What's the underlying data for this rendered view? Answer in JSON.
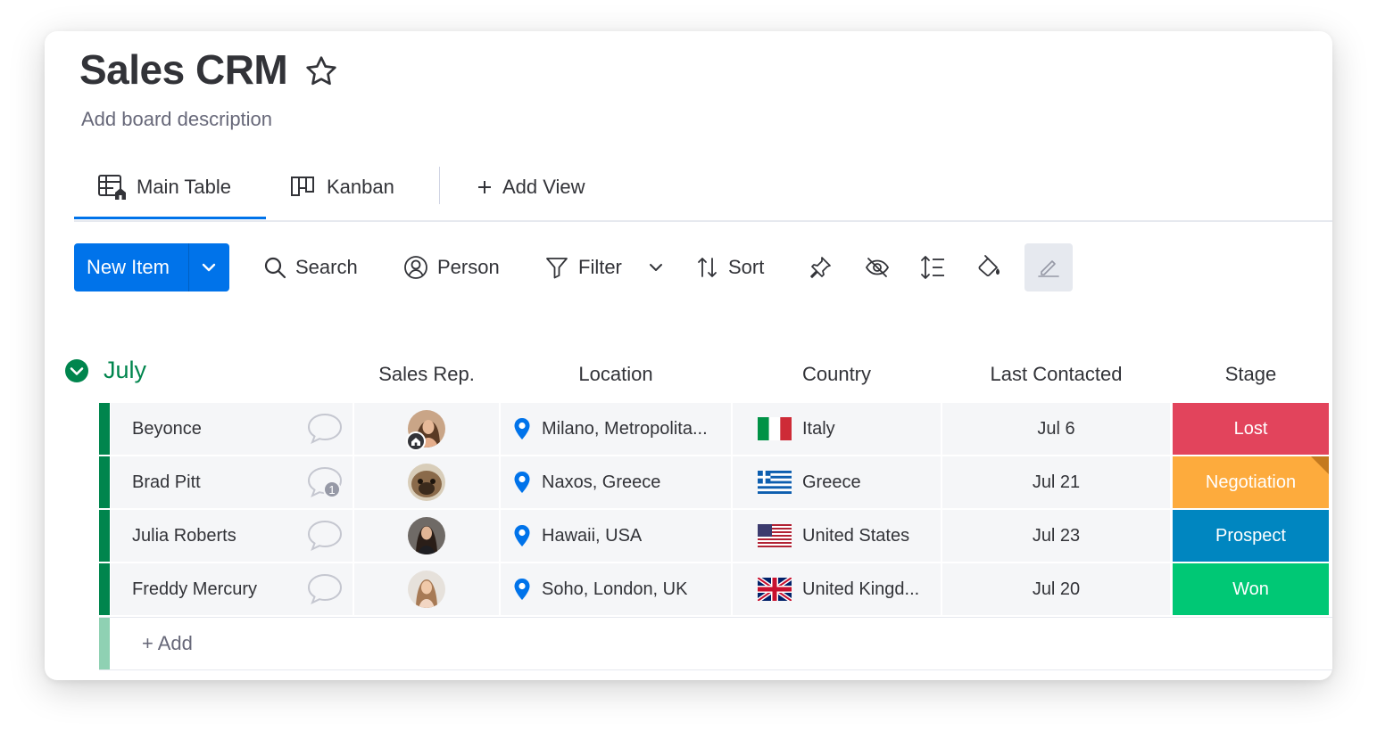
{
  "board": {
    "title": "Sales CRM",
    "description": "Add board description"
  },
  "tabs": [
    {
      "label": "Main Table",
      "active": true
    },
    {
      "label": "Kanban",
      "active": false
    },
    {
      "label": "Add View",
      "active": false
    }
  ],
  "toolbar": {
    "new_item": "New Item",
    "search": "Search",
    "person": "Person",
    "filter": "Filter",
    "sort": "Sort"
  },
  "group": {
    "title": "July",
    "color": "#00854d",
    "add_label": "+ Add"
  },
  "columns": [
    "Sales Rep.",
    "Location",
    "Country",
    "Last Contacted",
    "Stage"
  ],
  "rows": [
    {
      "name": "Beyonce",
      "updates": "",
      "location": "Milano, Metropolita...",
      "country": "Italy",
      "flag": "italy-flag",
      "last_contacted": "Jul 6",
      "stage": "Lost",
      "stage_color": "#e2445c"
    },
    {
      "name": "Brad Pitt",
      "updates": "1",
      "location": "Naxos, Greece",
      "country": "Greece",
      "flag": "greece-flag",
      "last_contacted": "Jul 21",
      "stage": "Negotiation",
      "stage_color": "#fdab3d"
    },
    {
      "name": "Julia Roberts",
      "updates": "",
      "location": "Hawaii, USA",
      "country": "United States",
      "flag": "usa-flag",
      "last_contacted": "Jul 23",
      "stage": "Prospect",
      "stage_color": "#0086c0"
    },
    {
      "name": "Freddy Mercury",
      "updates": "",
      "location": "Soho, London, UK",
      "country": "United Kingd...",
      "flag": "uk-flag",
      "last_contacted": "Jul 20",
      "stage": "Won",
      "stage_color": "#00c875"
    }
  ],
  "colors": {
    "accent": "#0073ea",
    "group": "#00854d"
  }
}
